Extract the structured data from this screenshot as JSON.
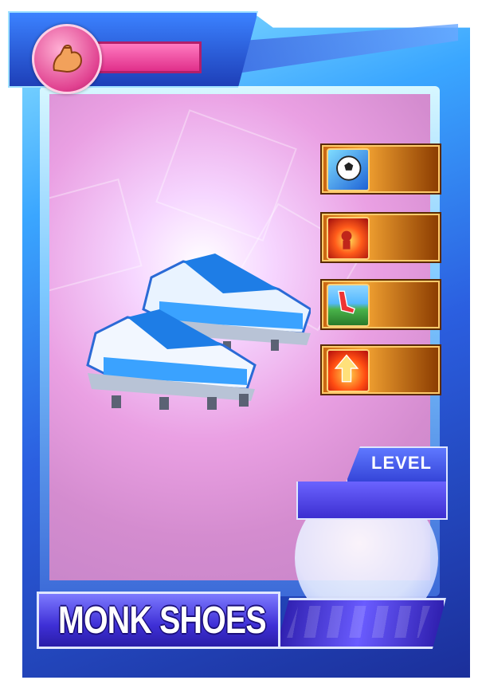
{
  "card": {
    "name": "MONK SHOES",
    "level_label": "LEVEL",
    "colors": {
      "frame": "#2b5fe0",
      "art_bg": "#e8a6e4",
      "stat_slot": "#f5a533",
      "name_plate": "#3e2fd6",
      "power_bar": "#e02f8a"
    }
  },
  "header": {
    "power_icon": "flexed-arm-icon",
    "power_bar_value": ""
  },
  "stats": [
    {
      "icon": "soccer-ball-icon",
      "value": ""
    },
    {
      "icon": "fire-player-icon",
      "value": ""
    },
    {
      "icon": "kick-icon",
      "value": ""
    },
    {
      "icon": "fire-arrow-up-icon",
      "value": ""
    }
  ],
  "item_art": "soccer-cleats-icon"
}
